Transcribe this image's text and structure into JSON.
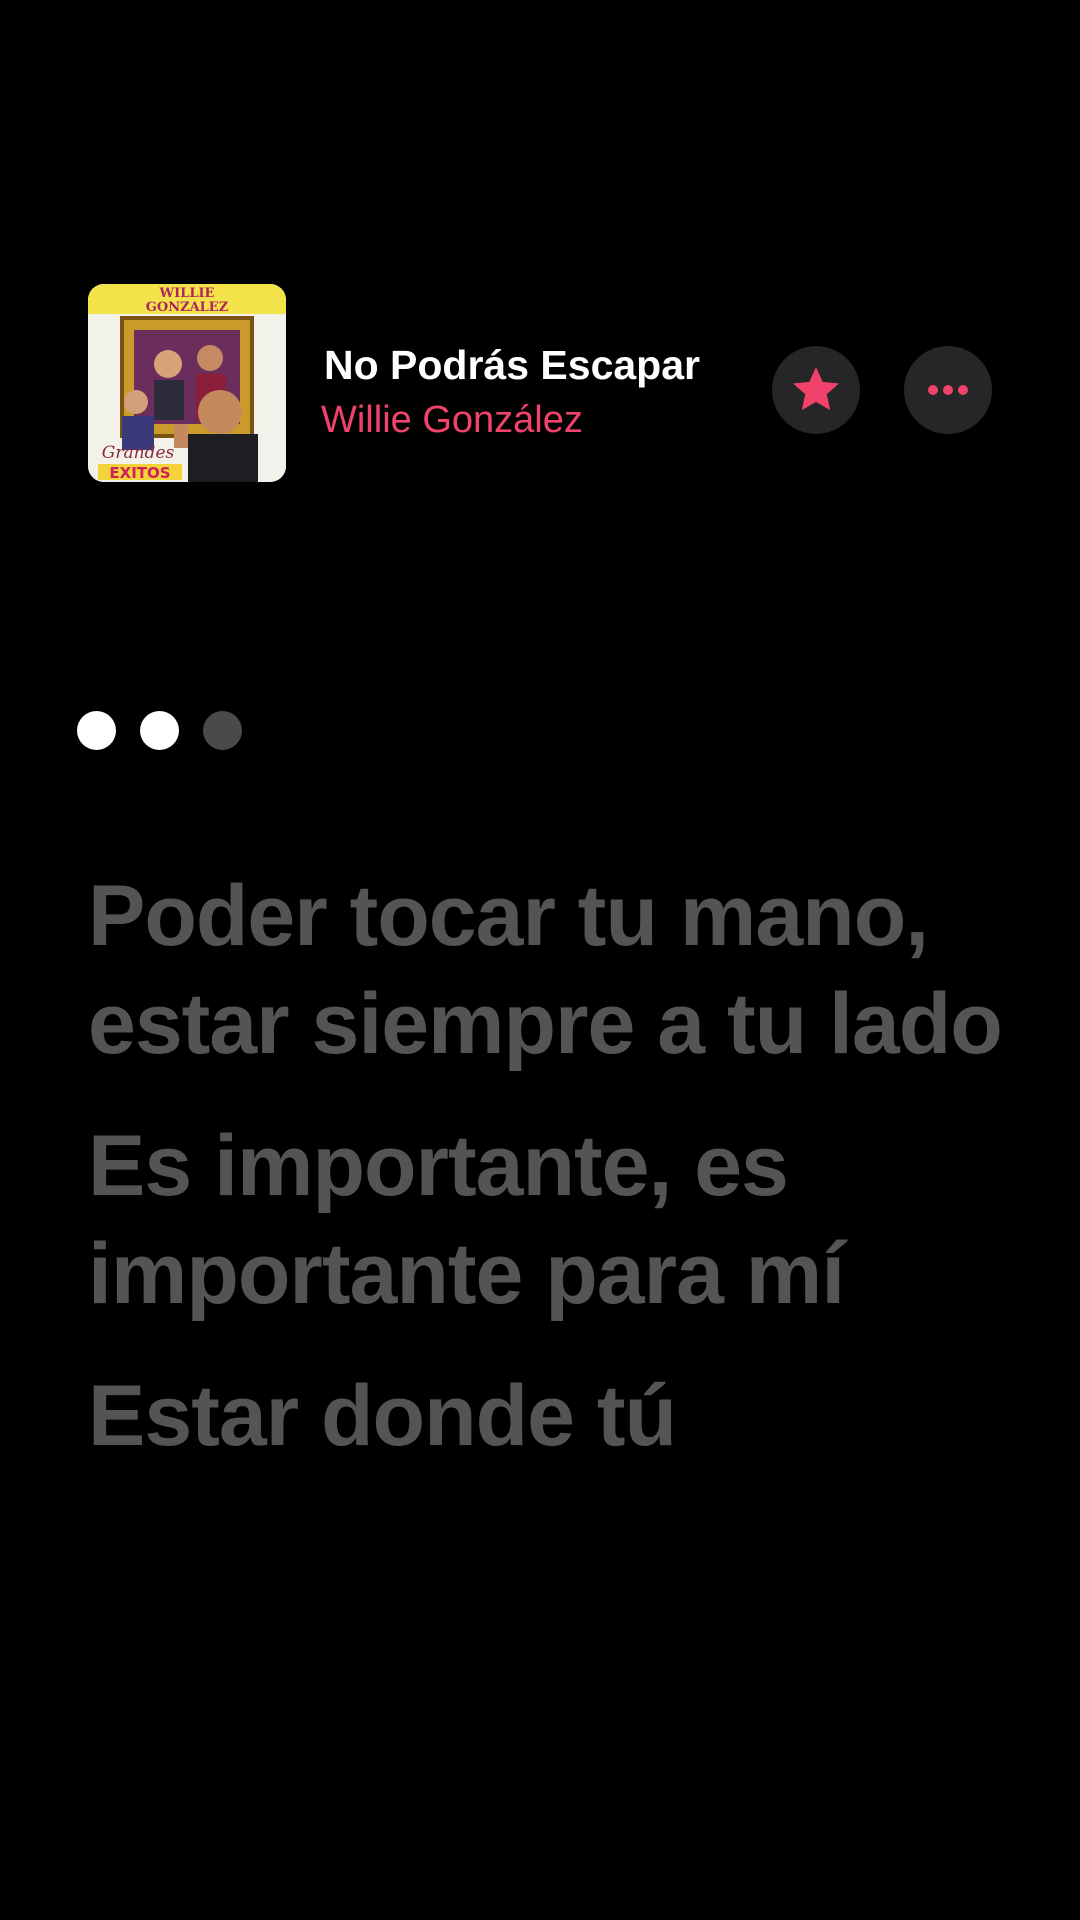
{
  "now_playing": {
    "title": "No Podrás Escapar",
    "artist": "Willie González",
    "artwork": {
      "artist_text": "WILLIE GONZALEZ",
      "album_text_line1": "Grandes",
      "album_text_line2": "EXITOS"
    },
    "favorite_icon": "star-icon",
    "more_icon": "ellipsis-icon"
  },
  "accent_color": "#f0426a",
  "beat_indicator": {
    "dots": [
      true,
      true,
      false
    ]
  },
  "lyrics": {
    "lines": [
      "Poder tocar tu mano, estar siempre a tu lado",
      "Es importante, es importante para mí",
      "Estar donde tú"
    ]
  }
}
